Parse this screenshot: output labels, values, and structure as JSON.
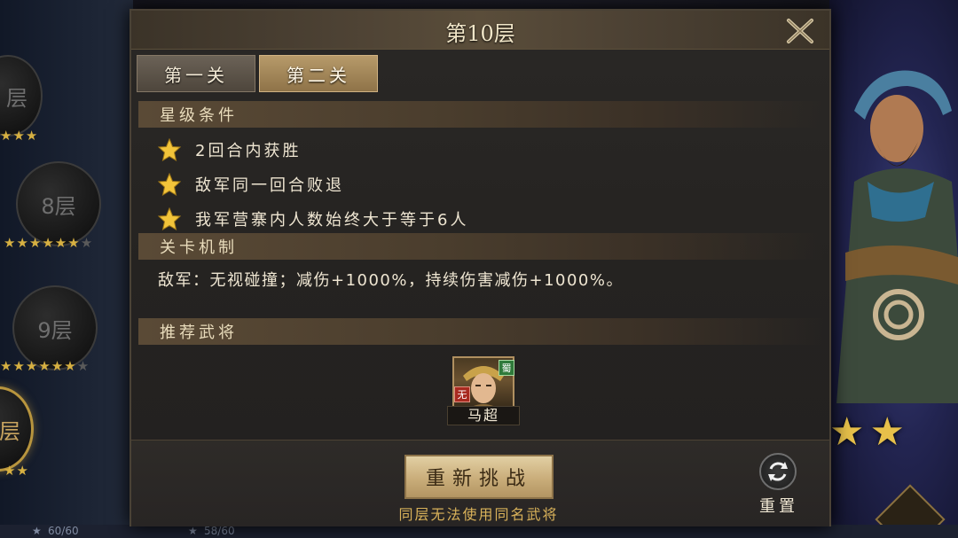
{
  "background": {
    "floors": [
      {
        "label": "层"
      },
      {
        "label": "8层"
      },
      {
        "label": "9层"
      },
      {
        "label": "层"
      }
    ],
    "bottom_left_score": "60/60",
    "bottom_mid_score": "58/60"
  },
  "modal": {
    "title": "第10层",
    "tabs": [
      {
        "label": "第一关",
        "active": false
      },
      {
        "label": "第二关",
        "active": true
      }
    ],
    "star_section_title": "星级条件",
    "conditions": [
      "2回合内获胜",
      "敌军同一回合败退",
      "我军营寨内人数始终大于等于6人"
    ],
    "mechanic_section_title": "关卡机制",
    "mechanic_text": "敌军：无视碰撞；减伤+1000%，持续伤害减伤+1000%。",
    "recommend_section_title": "推荐武将",
    "recommended_hero": {
      "name": "马超",
      "faction_badge": "蜀",
      "side_badge": "无"
    },
    "retry_button": "重新挑战",
    "footer_note": "同层无法使用同名武将",
    "reset_label": "重置"
  },
  "colors": {
    "gold_text": "#d9b25a",
    "star_gold": "#e7c04a",
    "tab_active": "#b79a6a"
  }
}
